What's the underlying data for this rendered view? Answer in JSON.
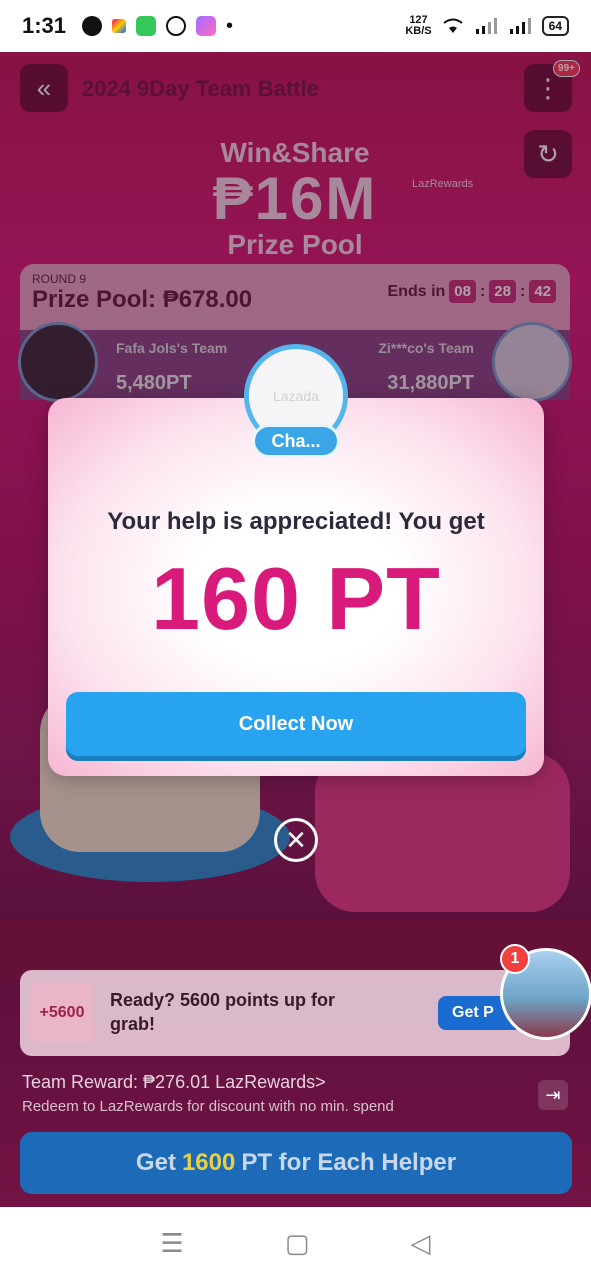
{
  "status_bar": {
    "time": "1:31",
    "net_speed_value": "127",
    "net_speed_unit": "KB/S",
    "battery": "64"
  },
  "game": {
    "title": "2024 9Day Team Battle",
    "notifications_badge": "99+",
    "hero": {
      "line1": "Win&Share",
      "line2": "₱16M",
      "line3": "Prize Pool",
      "tag": "LazRewards"
    },
    "round": {
      "label": "ROUND 9",
      "prize_pool": "Prize Pool: ₱678.00",
      "ends_in_label": "Ends in",
      "hours": "08",
      "minutes": "28",
      "seconds": "42"
    },
    "teams": {
      "left": {
        "name": "Fafa Jols's Team",
        "points": "5,480PT"
      },
      "right": {
        "name": "Zi***co's Team",
        "points": "31,880PT"
      }
    },
    "promo": {
      "points": "+5600",
      "text": "Ready? 5600 points up for grab!",
      "button": "Get P"
    },
    "floating_notif_count": "1",
    "team_reward": "Team Reward: ₱276.01 LazRewards>",
    "redeem_text": "Redeem to LazRewards for discount with no min. spend",
    "bottom_button": {
      "prefix": "Get",
      "number": "1600",
      "suffix": "PT for Each Helper"
    }
  },
  "modal": {
    "avatar_text": "Lazada",
    "tag": "Cha...",
    "message": "Your help is appreciated! You get",
    "points": "160 PT",
    "collect_button": "Collect Now"
  },
  "colors": {
    "accent_pink": "#d81b7a",
    "button_blue": "#27a3ef"
  }
}
